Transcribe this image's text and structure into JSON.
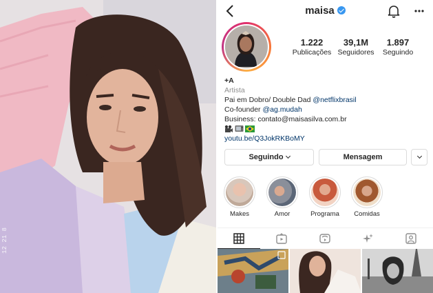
{
  "header": {
    "username": "maisa",
    "verified": true
  },
  "stats": {
    "posts": {
      "value": "1.222",
      "label": "Publicações"
    },
    "followers": {
      "value": "39,1M",
      "label": "Seguidores"
    },
    "following": {
      "value": "1.897",
      "label": "Seguindo"
    }
  },
  "bio": {
    "name": "+A",
    "category": "Artista",
    "line1_text": "Pai em Dobro/ Double Dad ",
    "line1_mention": "@netflixbrasil",
    "line2_text": "Co-founder ",
    "line2_mention": "@ag.mudah",
    "line3": "Business: contato@maisasilva.com.br",
    "emojis": [
      "movie-camera-emoji",
      "tv-emoji",
      "brazil-flag-emoji"
    ],
    "link": "youtu.be/Q3JokRKBoMY"
  },
  "buttons": {
    "following_label": "Seguindo",
    "message_label": "Mensagem"
  },
  "highlights": [
    {
      "label": "Makes"
    },
    {
      "label": "Amor"
    },
    {
      "label": "Programa"
    },
    {
      "label": "Comidas"
    }
  ],
  "tabs": [
    "grid-icon",
    "igtv-icon",
    "reels-icon",
    "effects-icon",
    "tagged-icon"
  ],
  "photo_watermark": "12 21 8",
  "colors": {
    "link": "#003569",
    "verified": "#3897f0",
    "text": "#262626",
    "muted": "#8e8e8e"
  }
}
